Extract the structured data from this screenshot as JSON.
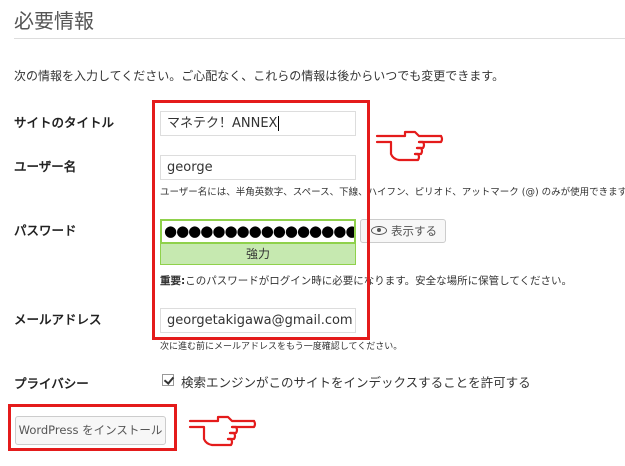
{
  "page": {
    "title": "必要情報",
    "intro": "次の情報を入力してください。ご心配なく、これらの情報は後からいつでも変更できます。"
  },
  "form": {
    "site_title": {
      "label": "サイトのタイトル",
      "value": "マネテク！ANNEX"
    },
    "username": {
      "label": "ユーザー名",
      "value": "george",
      "help": "ユーザー名には、半角英数字、スペース、下線、ハイフン、ピリオド、アットマーク (@) のみが使用できます。"
    },
    "password": {
      "label": "パスワード",
      "masked_value": "●●●●●●●●●●●●●●●●●",
      "strength": "強力",
      "show_button": "表示する",
      "note_bold": "重要:",
      "note": "このパスワードがログイン時に必要になります。安全な場所に保管してください。"
    },
    "email": {
      "label": "メールアドレス",
      "value": "georgetakigawa@gmail.com",
      "help": "次に進む前にメールアドレスをもう一度確認してください。"
    },
    "privacy": {
      "label": "プライバシー",
      "checked": true,
      "checkbox_label": "検索エンジンがこのサイトをインデックスすることを許可する"
    }
  },
  "submit": {
    "label": "WordPress をインストール"
  },
  "colors": {
    "annotation_red": "#e41b1b",
    "strength_green": "#c6e9b0"
  }
}
